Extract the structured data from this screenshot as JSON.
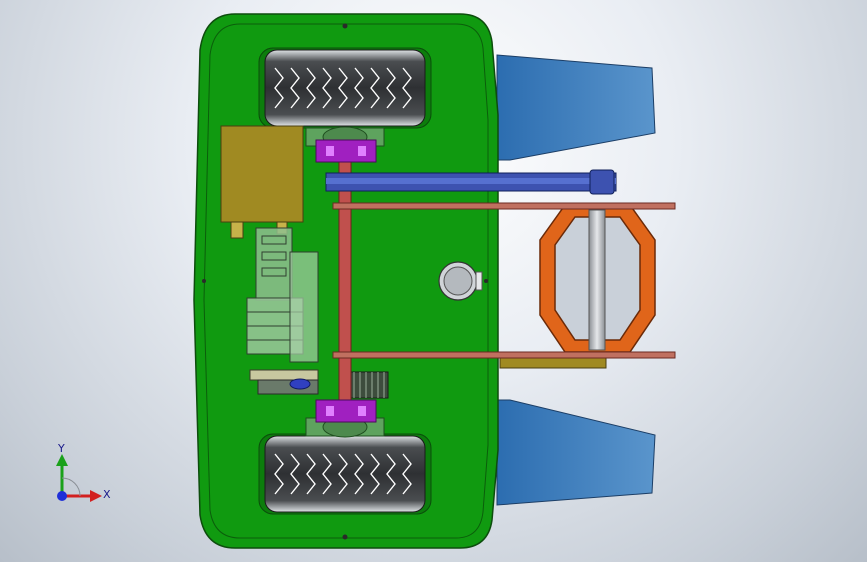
{
  "viewport": {
    "model": "vehicle-chassis-assembly",
    "view": "bottom"
  },
  "triad": {
    "x_label": "X",
    "y_label": "Y",
    "x_color": "#d22020",
    "y_color": "#1aa11a",
    "z_color": "#1f2fd8"
  },
  "colors": {
    "chassis": "#109a10",
    "chassis_edge": "#0d4d0d",
    "tire": "#3a3d40",
    "axle": "#c0504d",
    "bracket": "#a020c0",
    "battery": "#a08a22",
    "belt": "#3d52b0",
    "rod": "#c07060",
    "wheel_ring": "#e0651a",
    "deflector": "#4a86c2",
    "knob": "#d0d4d8"
  }
}
